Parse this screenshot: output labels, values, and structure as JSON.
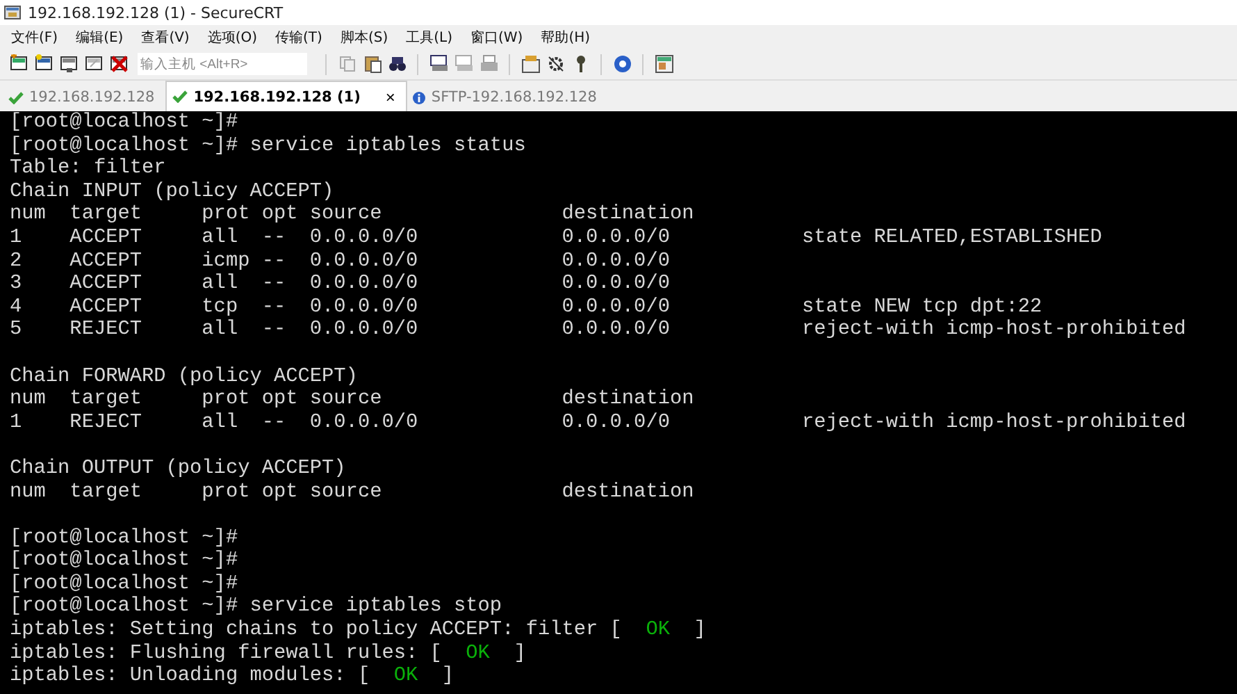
{
  "window": {
    "title": "192.168.192.128 (1) - SecureCRT"
  },
  "menu": [
    "文件(F)",
    "编辑(E)",
    "查看(V)",
    "选项(O)",
    "传输(T)",
    "脚本(S)",
    "工具(L)",
    "窗口(W)",
    "帮助(H)"
  ],
  "toolbar": {
    "host_field": {
      "placeholder": "输入主机 <Alt+R>"
    }
  },
  "tabs": [
    {
      "label": "192.168.192.128",
      "selected": false,
      "kind": "connected"
    },
    {
      "label": "192.168.192.128 (1)",
      "selected": true,
      "kind": "connected",
      "close": "×"
    },
    {
      "label": "SFTP-192.168.192.128",
      "selected": false,
      "kind": "info"
    }
  ],
  "terminal": {
    "lines": [
      {
        "kind": "plain",
        "text": "[root@localhost ~]#"
      },
      {
        "kind": "plain",
        "text": "[root@localhost ~]# service iptables status"
      },
      {
        "kind": "plain",
        "text": "Table: filter"
      },
      {
        "kind": "plain",
        "text": "Chain INPUT (policy ACCEPT)"
      },
      {
        "kind": "plain",
        "text": "num  target     prot opt source               destination"
      },
      {
        "kind": "plain",
        "text": "1    ACCEPT     all  --  0.0.0.0/0            0.0.0.0/0           state RELATED,ESTABLISHED"
      },
      {
        "kind": "plain",
        "text": "2    ACCEPT     icmp --  0.0.0.0/0            0.0.0.0/0"
      },
      {
        "kind": "plain",
        "text": "3    ACCEPT     all  --  0.0.0.0/0            0.0.0.0/0"
      },
      {
        "kind": "plain",
        "text": "4    ACCEPT     tcp  --  0.0.0.0/0            0.0.0.0/0           state NEW tcp dpt:22"
      },
      {
        "kind": "plain",
        "text": "5    REJECT     all  --  0.0.0.0/0            0.0.0.0/0           reject-with icmp-host-prohibited"
      },
      {
        "kind": "blank"
      },
      {
        "kind": "plain",
        "text": "Chain FORWARD (policy ACCEPT)"
      },
      {
        "kind": "plain",
        "text": "num  target     prot opt source               destination"
      },
      {
        "kind": "plain",
        "text": "1    REJECT     all  --  0.0.0.0/0            0.0.0.0/0           reject-with icmp-host-prohibited"
      },
      {
        "kind": "blank"
      },
      {
        "kind": "plain",
        "text": "Chain OUTPUT (policy ACCEPT)"
      },
      {
        "kind": "plain",
        "text": "num  target     prot opt source               destination"
      },
      {
        "kind": "blank"
      },
      {
        "kind": "plain",
        "text": "[root@localhost ~]#"
      },
      {
        "kind": "plain",
        "text": "[root@localhost ~]#"
      },
      {
        "kind": "plain",
        "text": "[root@localhost ~]#"
      },
      {
        "kind": "plain",
        "text": "[root@localhost ~]# service iptables stop"
      },
      {
        "kind": "status",
        "prefix": "iptables: Setting chains to policy ACCEPT: filter [",
        "status": "OK",
        "suffix": "]"
      },
      {
        "kind": "status",
        "prefix": "iptables: Flushing firewall rules: [",
        "status": "OK",
        "suffix": "]"
      },
      {
        "kind": "status",
        "prefix": "iptables: Unloading modules: [",
        "status": "OK",
        "suffix": "]"
      }
    ]
  }
}
